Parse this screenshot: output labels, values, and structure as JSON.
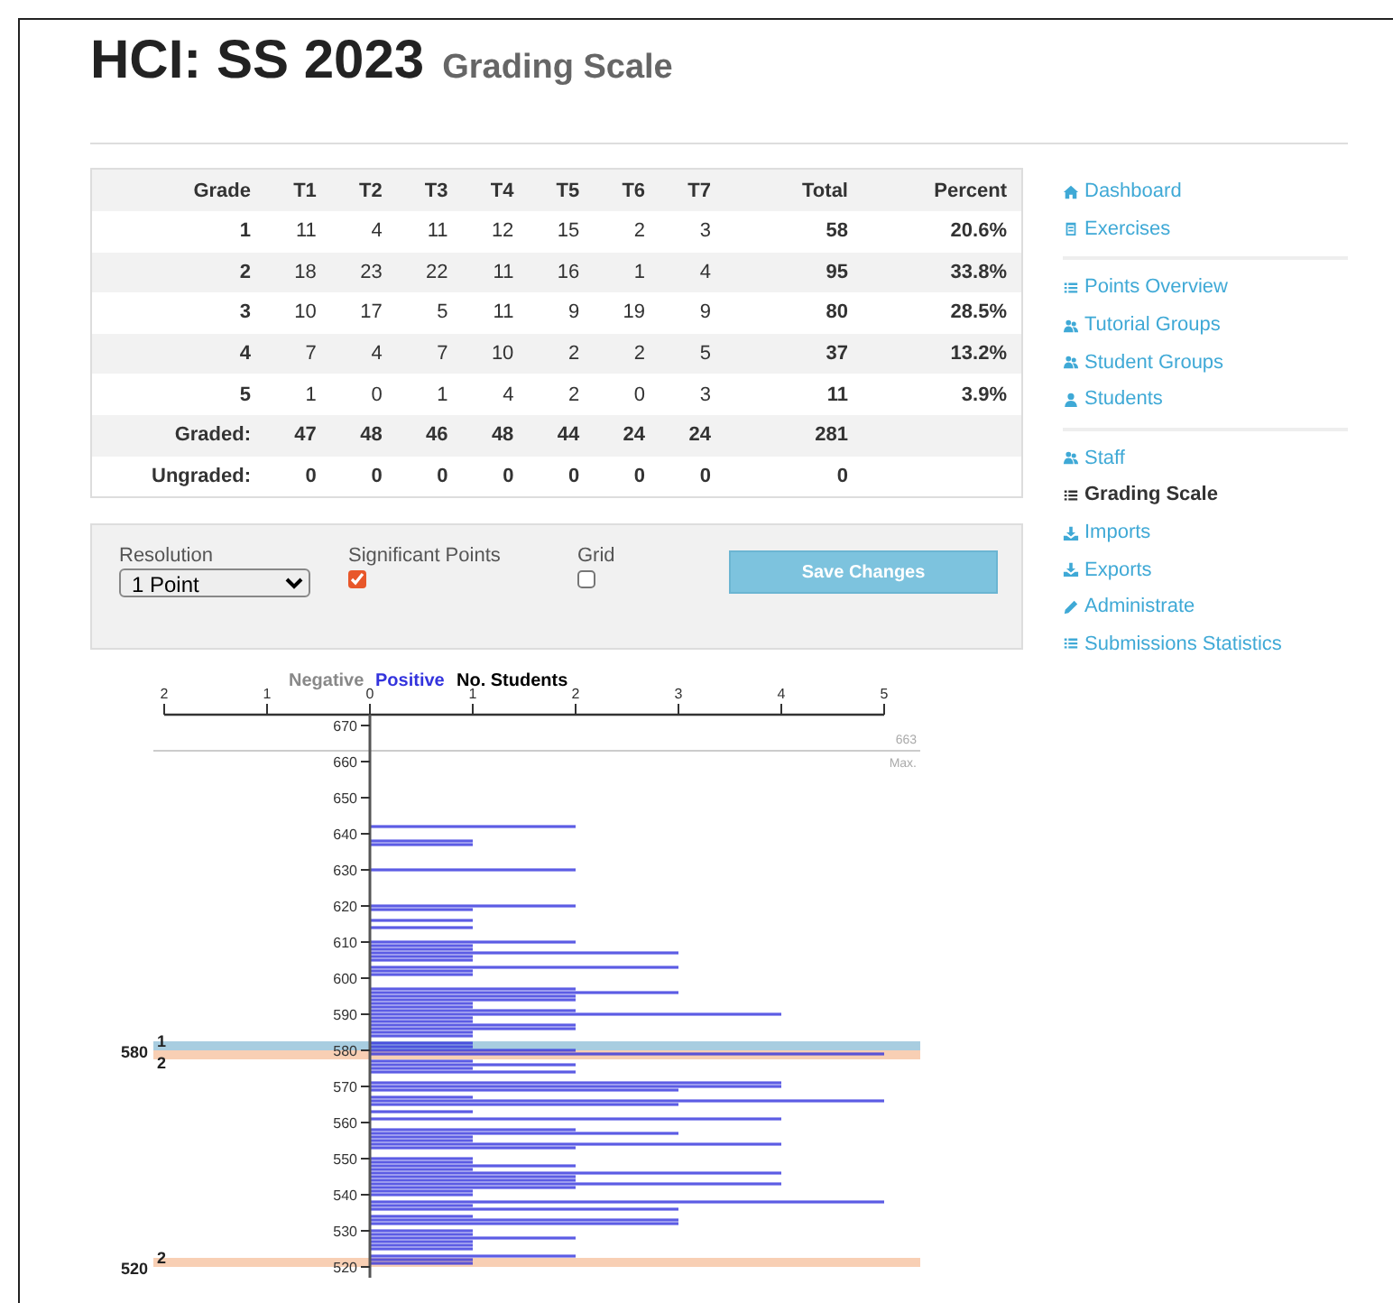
{
  "header": {
    "title": "HCI: SS 2023",
    "subtitle": "Grading Scale"
  },
  "table": {
    "columns": [
      "Grade",
      "T1",
      "T2",
      "T3",
      "T4",
      "T5",
      "T6",
      "T7",
      "Total",
      "Percent"
    ],
    "rows": [
      {
        "kind": "grade",
        "cells": [
          "1",
          "11",
          "4",
          "11",
          "12",
          "15",
          "2",
          "3",
          "58",
          "20.6%"
        ]
      },
      {
        "kind": "grade",
        "cells": [
          "2",
          "18",
          "23",
          "22",
          "11",
          "16",
          "1",
          "4",
          "95",
          "33.8%"
        ]
      },
      {
        "kind": "grade",
        "cells": [
          "3",
          "10",
          "17",
          "5",
          "11",
          "9",
          "19",
          "9",
          "80",
          "28.5%"
        ]
      },
      {
        "kind": "grade",
        "cells": [
          "4",
          "7",
          "4",
          "7",
          "10",
          "2",
          "2",
          "5",
          "37",
          "13.2%"
        ]
      },
      {
        "kind": "grade",
        "cells": [
          "5",
          "1",
          "0",
          "1",
          "4",
          "2",
          "0",
          "3",
          "11",
          "3.9%"
        ]
      },
      {
        "kind": "summary",
        "cells": [
          "Graded:",
          "47",
          "48",
          "46",
          "48",
          "44",
          "24",
          "24",
          "281",
          ""
        ]
      },
      {
        "kind": "summary",
        "cells": [
          "Ungraded:",
          "0",
          "0",
          "0",
          "0",
          "0",
          "0",
          "0",
          "0",
          ""
        ]
      }
    ]
  },
  "controls": {
    "resolution": {
      "label": "Resolution",
      "value": "1 Point"
    },
    "significant_points": {
      "label": "Significant Points",
      "checked": true
    },
    "grid": {
      "label": "Grid",
      "checked": false
    },
    "save_button": "Save Changes"
  },
  "chart": {
    "negative_legend": {
      "label": "Negative",
      "color": "#888888"
    },
    "max_label": "Max.",
    "boundaries": [
      {
        "value": "580",
        "above": "1",
        "below": "2"
      },
      {
        "value": "520",
        "above": "2"
      }
    ],
    "chart_data": {
      "type": "bar",
      "orientation": "horizontal",
      "xlabel": "No. Students",
      "xlim": [
        -2,
        5
      ],
      "ylim": [
        517,
        673
      ],
      "xticks": [
        {
          "value": -2,
          "label": "2"
        },
        {
          "value": -1,
          "label": "1"
        },
        {
          "value": 0,
          "label": "0"
        },
        {
          "value": 1,
          "label": "1"
        },
        {
          "value": 2,
          "label": "2"
        },
        {
          "value": 3,
          "label": "3"
        },
        {
          "value": 4,
          "label": "4"
        },
        {
          "value": 5,
          "label": "5"
        }
      ],
      "yticks": [
        {
          "value": 520,
          "label": "520"
        },
        {
          "value": 530,
          "label": "530"
        },
        {
          "value": 540,
          "label": "540"
        },
        {
          "value": 550,
          "label": "550"
        },
        {
          "value": 560,
          "label": "560"
        },
        {
          "value": 570,
          "label": "570"
        },
        {
          "value": 580,
          "label": "580"
        },
        {
          "value": 590,
          "label": "590"
        },
        {
          "value": 600,
          "label": "600"
        },
        {
          "value": 610,
          "label": "610"
        },
        {
          "value": 620,
          "label": "620"
        },
        {
          "value": 630,
          "label": "630"
        },
        {
          "value": 640,
          "label": "640"
        },
        {
          "value": 650,
          "label": "650"
        },
        {
          "value": 660,
          "label": "660"
        },
        {
          "value": 670,
          "label": "670"
        }
      ],
      "ref_lines": [
        {
          "axis": "y",
          "value": 663,
          "label": "663"
        }
      ],
      "bands": [
        {
          "axis": "y",
          "from": 580,
          "to": 582.5,
          "color": "#a8cde0"
        },
        {
          "axis": "y",
          "from": 577.5,
          "to": 580,
          "color": "#f8cfb4"
        },
        {
          "axis": "y",
          "from": 520,
          "to": 522.5,
          "color": "#f8cfb4"
        }
      ],
      "x": [
        642,
        638,
        637,
        630,
        620,
        619,
        616,
        614,
        610,
        609,
        608,
        607,
        606,
        605,
        603,
        602,
        601,
        597,
        596,
        595,
        594,
        593,
        592,
        591,
        590,
        589,
        588,
        587,
        586,
        585,
        584,
        582,
        581,
        580,
        579,
        577,
        576,
        575,
        574,
        571,
        570,
        569,
        567,
        566,
        565,
        563,
        561,
        558,
        557,
        556,
        555,
        554,
        553,
        550,
        549,
        548,
        547,
        546,
        545,
        544,
        543,
        542,
        541,
        540,
        538,
        537,
        536,
        534,
        533,
        532,
        530,
        529,
        528,
        527,
        526,
        525,
        523,
        522,
        521
      ],
      "series": [
        {
          "name": "Positive",
          "color": "#3333dd",
          "values": [
            2,
            1,
            1,
            2,
            2,
            1,
            1,
            1,
            2,
            1,
            1,
            3,
            1,
            1,
            3,
            1,
            1,
            2,
            3,
            2,
            2,
            1,
            1,
            2,
            4,
            1,
            1,
            2,
            2,
            1,
            1,
            1,
            1,
            2,
            5,
            1,
            2,
            1,
            2,
            4,
            4,
            3,
            1,
            5,
            3,
            1,
            4,
            2,
            3,
            1,
            1,
            4,
            2,
            1,
            1,
            2,
            1,
            4,
            2,
            2,
            4,
            2,
            1,
            1,
            5,
            1,
            3,
            1,
            3,
            3,
            1,
            1,
            2,
            1,
            1,
            1,
            2,
            1,
            1
          ]
        }
      ]
    }
  },
  "nav": {
    "sections": [
      {
        "items": [
          {
            "label": "Dashboard",
            "kind": "home",
            "selected": false
          },
          {
            "label": "Exercises",
            "kind": "clipboard",
            "selected": false
          }
        ]
      },
      {
        "items": [
          {
            "label": "Points Overview",
            "kind": "list",
            "selected": false
          },
          {
            "label": "Tutorial Groups",
            "kind": "group",
            "selected": false
          },
          {
            "label": "Student Groups",
            "kind": "group",
            "selected": false
          },
          {
            "label": "Students",
            "kind": "user",
            "selected": false
          }
        ]
      },
      {
        "items": [
          {
            "label": "Staff",
            "kind": "group",
            "selected": false
          },
          {
            "label": "Grading Scale",
            "kind": "list",
            "selected": true
          },
          {
            "label": "Imports",
            "kind": "download",
            "selected": false
          },
          {
            "label": "Exports",
            "kind": "download",
            "selected": false
          },
          {
            "label": "Administrate",
            "kind": "pencil",
            "selected": false
          },
          {
            "label": "Submissions Statistics",
            "kind": "list",
            "selected": false
          }
        ]
      }
    ]
  }
}
